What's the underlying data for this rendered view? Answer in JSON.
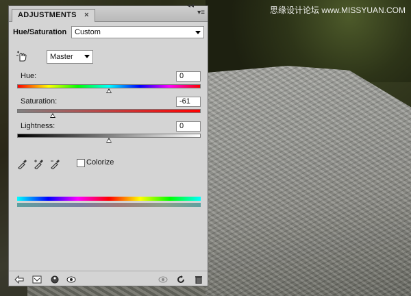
{
  "panel": {
    "tab_label": "ADJUSTMENTS",
    "tab_close": "×",
    "collapse_glyph": "◂◂",
    "menu_glyph": "▾≡",
    "title": "Hue/Saturation",
    "preset": "Custom",
    "channel": "Master"
  },
  "sliders": {
    "hue": {
      "label": "Hue:",
      "value": "0",
      "fraction": 0.5
    },
    "saturation": {
      "label": "Saturation:",
      "value": "-61",
      "fraction": 0.195
    },
    "lightness": {
      "label": "Lightness:",
      "value": "0",
      "fraction": 0.5
    }
  },
  "colorize": {
    "label": "Colorize",
    "checked": false
  },
  "watermark": "思缘设计论坛 www.MISSYUAN.COM",
  "icons": {
    "hand": "targeted-adjustment-icon",
    "eyedroppers": [
      "eyedropper-icon",
      "eyedropper-plus-icon",
      "eyedropper-minus-icon"
    ],
    "footer": [
      "return-arrow-icon",
      "clip-layer-icon",
      "visibility-circle-icon",
      "eye-icon",
      "view-previous-icon",
      "reset-icon",
      "trash-icon"
    ]
  }
}
